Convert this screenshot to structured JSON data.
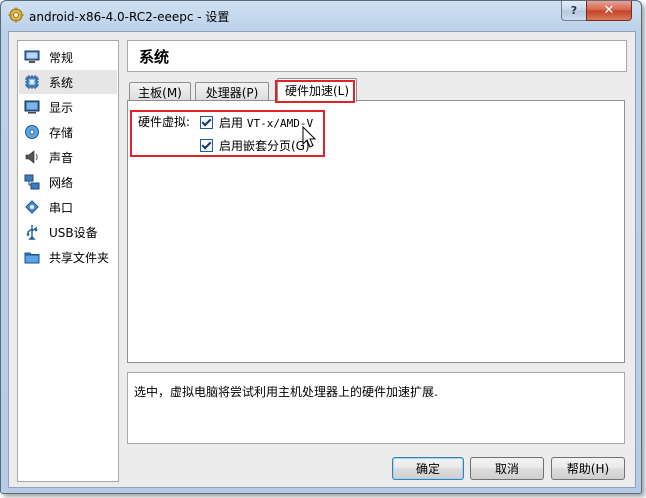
{
  "window": {
    "title": "android-x86-4.0-RC2-eeepc - 设置",
    "help_icon": "?",
    "close_icon": "✕"
  },
  "sidebar": {
    "items": [
      {
        "label": "常规",
        "icon": "monitor-icon"
      },
      {
        "label": "系统",
        "icon": "chip-icon"
      },
      {
        "label": "显示",
        "icon": "display-icon"
      },
      {
        "label": "存储",
        "icon": "disk-icon"
      },
      {
        "label": "声音",
        "icon": "speaker-icon"
      },
      {
        "label": "网络",
        "icon": "network-icon"
      },
      {
        "label": "串口",
        "icon": "serial-port-icon"
      },
      {
        "label": "USB设备",
        "icon": "usb-icon"
      },
      {
        "label": "共享文件夹",
        "icon": "folder-icon"
      }
    ],
    "selected": "系统"
  },
  "main": {
    "section_title": "系统",
    "tabs": [
      {
        "label": "主板(M)"
      },
      {
        "label": "处理器(P)"
      },
      {
        "label": "硬件加速(L)"
      }
    ],
    "active_tab": "硬件加速(L)",
    "hardware": {
      "row_label": "硬件虚拟:",
      "vtx_prefix": "启用",
      "vtx_name": "VT-x/AMD-V",
      "vtx_checked": true,
      "nested_label": "启用嵌套分页(G)",
      "nested_checked": true
    },
    "description": "选中，虚拟电脑将尝试利用主机处理器上的硬件加速扩展."
  },
  "buttons": {
    "ok": "确定",
    "cancel": "取消",
    "help": "帮助(H)"
  },
  "colors": {
    "highlight_box": "#e0222a",
    "selection": "#e6e6e6"
  }
}
